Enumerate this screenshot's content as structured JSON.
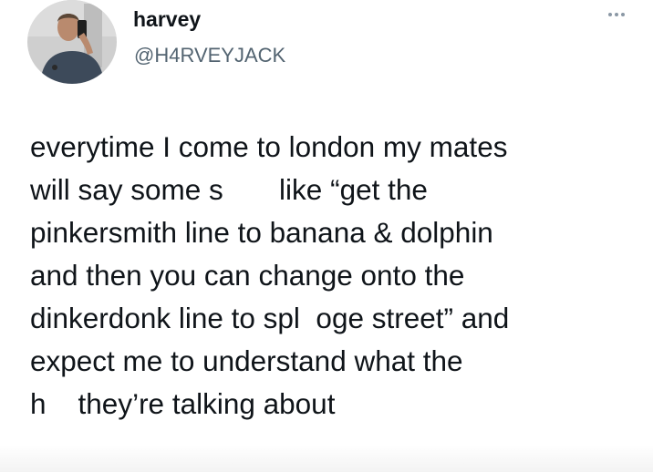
{
  "author": {
    "display_name": "harvey",
    "handle": "@H4RVEYJACK",
    "avatar_icon": "profile-photo"
  },
  "menu": {
    "icon": "more-options-icon"
  },
  "tweet": {
    "lines": [
      "everytime I come to london my mates",
      "will say some s       like “get the",
      "pinkersmith line to banana & dolphin",
      "and then you can change onto the",
      "dinkerdonk line to spl  oge street” and",
      "expect me to understand what the",
      "h    they’re talking about"
    ]
  },
  "colors": {
    "text": "#0f1419",
    "secondary_text": "#536471",
    "background": "#ffffff"
  }
}
